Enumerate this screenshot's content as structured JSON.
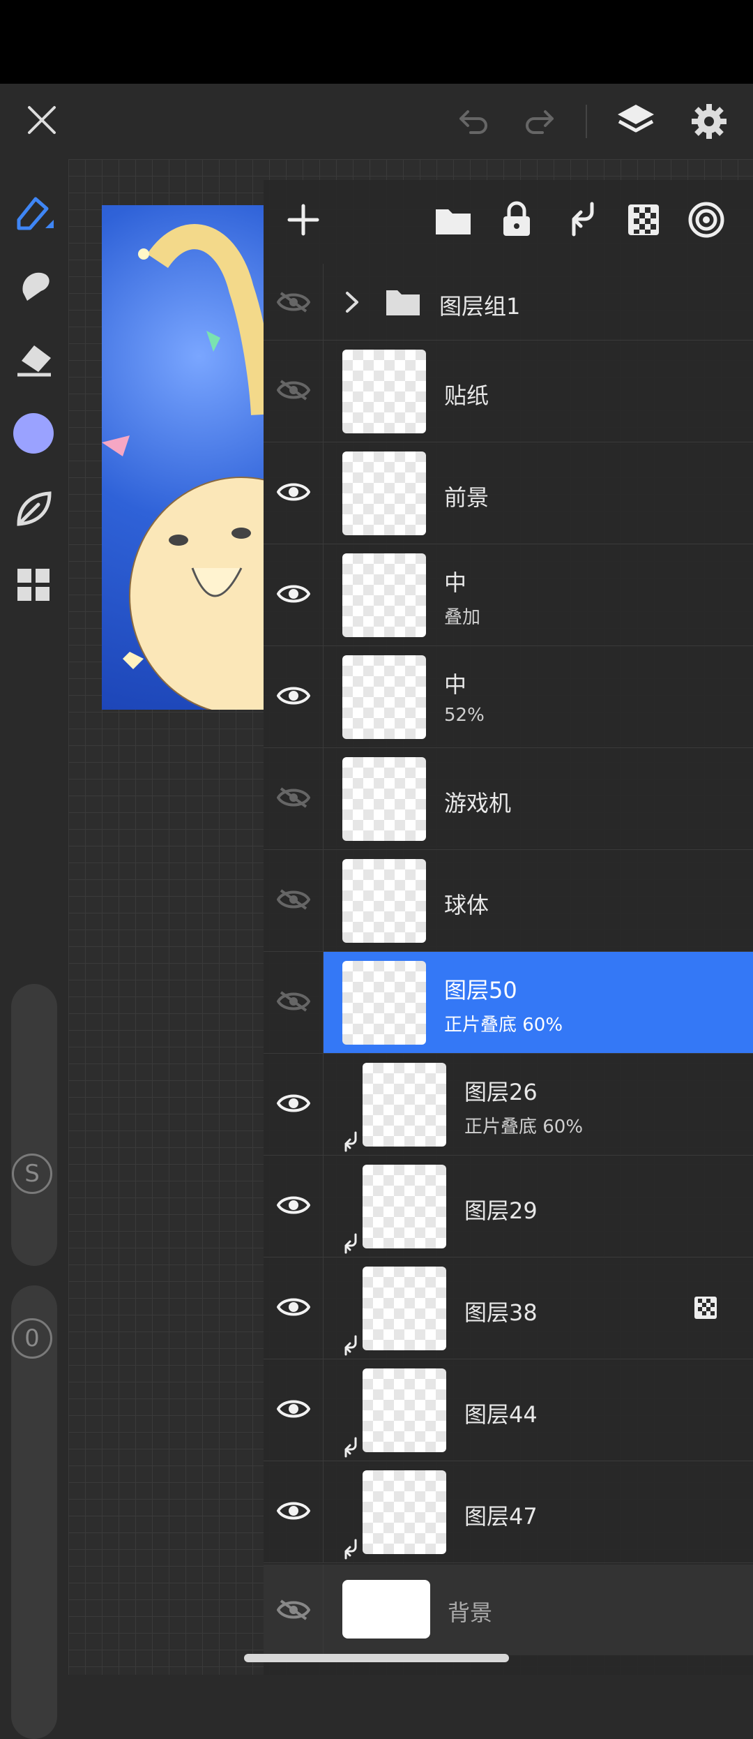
{
  "top_bar": {
    "close_icon": "close-icon",
    "undo_icon": "undo-icon",
    "redo_icon": "redo-icon",
    "layers_icon": "layers-icon",
    "settings_icon": "gear-icon"
  },
  "left_toolbar": {
    "tools": [
      "brush-icon",
      "smudge-icon",
      "eraser-icon",
      "color-swatch",
      "leaf-icon",
      "grid-menu-icon"
    ],
    "color": "#9aa2ff",
    "size_slider_label": "S",
    "opacity_slider_label": "0"
  },
  "layers_panel": {
    "toolbar_icons": [
      "add-icon",
      "folder-icon",
      "lock-icon",
      "merge-down-icon",
      "alpha-lock-icon",
      "target-icon"
    ],
    "group": {
      "name": "图层组1",
      "visible": false
    },
    "layers": [
      {
        "name": "贴纸",
        "sub": "",
        "visible": false,
        "selected": false,
        "clipped": false
      },
      {
        "name": "前景",
        "sub": "",
        "visible": true,
        "selected": false,
        "clipped": false
      },
      {
        "name": "中",
        "sub": "叠加",
        "visible": true,
        "selected": false,
        "clipped": false
      },
      {
        "name": "中",
        "sub": "52%",
        "visible": true,
        "selected": false,
        "clipped": false
      },
      {
        "name": "游戏机",
        "sub": "",
        "visible": false,
        "selected": false,
        "clipped": false
      },
      {
        "name": "球体",
        "sub": "",
        "visible": false,
        "selected": false,
        "clipped": false
      },
      {
        "name": "图层50",
        "sub": "正片叠底 60%",
        "visible": false,
        "selected": true,
        "clipped": false
      },
      {
        "name": "图层26",
        "sub": "正片叠底 60%",
        "visible": true,
        "selected": false,
        "clipped": true
      },
      {
        "name": "图层29",
        "sub": "",
        "visible": true,
        "selected": false,
        "clipped": true
      },
      {
        "name": "图层38",
        "sub": "",
        "visible": true,
        "selected": false,
        "clipped": true
      },
      {
        "name": "图层44",
        "sub": "",
        "visible": true,
        "selected": false,
        "clipped": true
      },
      {
        "name": "图层47",
        "sub": "",
        "visible": true,
        "selected": false,
        "clipped": true
      }
    ],
    "background": {
      "name": "背景",
      "visible": false
    }
  },
  "colors": {
    "accent": "#3478f6",
    "panel_bg": "#2b2b2b"
  }
}
